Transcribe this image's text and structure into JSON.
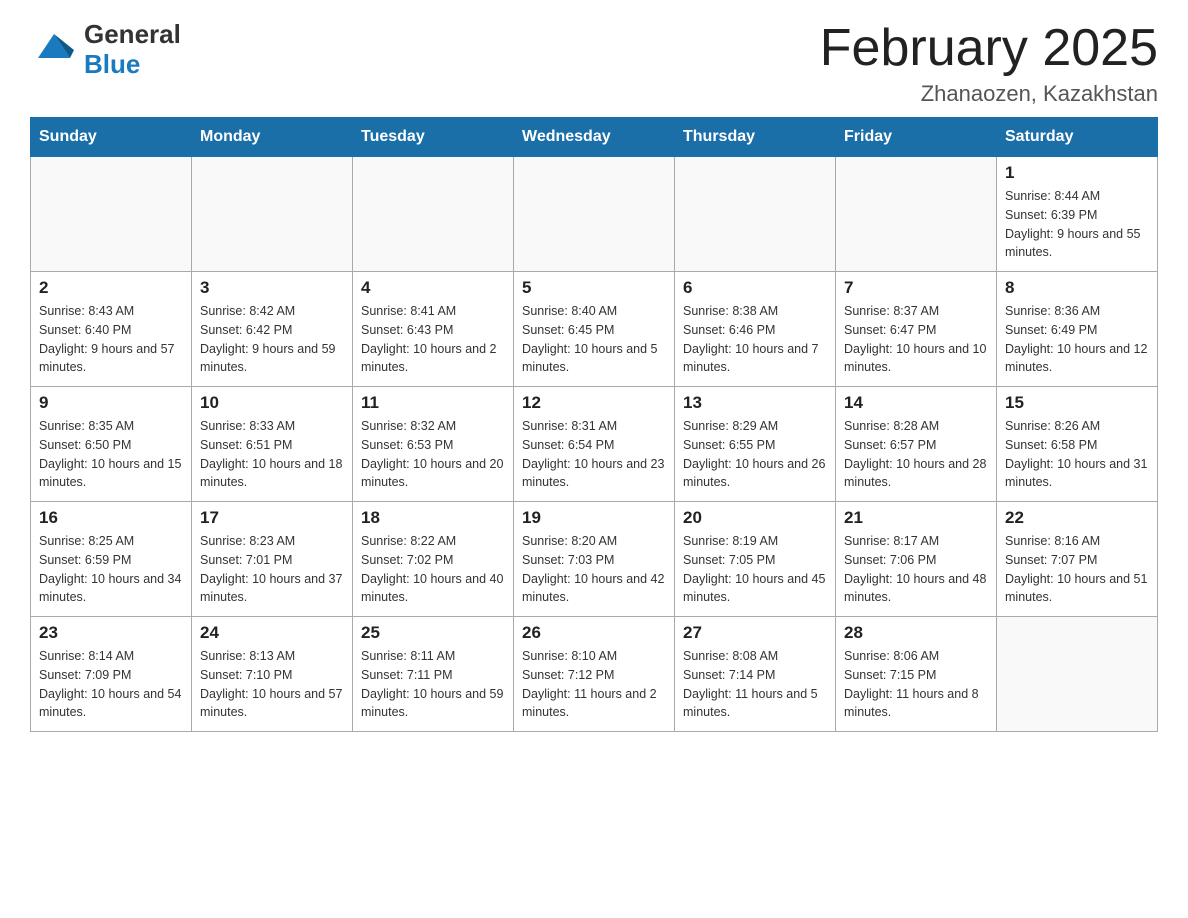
{
  "header": {
    "title": "February 2025",
    "location": "Zhanaozen, Kazakhstan"
  },
  "logo": {
    "general": "General",
    "blue": "Blue"
  },
  "days_of_week": [
    "Sunday",
    "Monday",
    "Tuesday",
    "Wednesday",
    "Thursday",
    "Friday",
    "Saturday"
  ],
  "weeks": [
    [
      {
        "date": "",
        "sunrise": "",
        "sunset": "",
        "daylight": ""
      },
      {
        "date": "",
        "sunrise": "",
        "sunset": "",
        "daylight": ""
      },
      {
        "date": "",
        "sunrise": "",
        "sunset": "",
        "daylight": ""
      },
      {
        "date": "",
        "sunrise": "",
        "sunset": "",
        "daylight": ""
      },
      {
        "date": "",
        "sunrise": "",
        "sunset": "",
        "daylight": ""
      },
      {
        "date": "",
        "sunrise": "",
        "sunset": "",
        "daylight": ""
      },
      {
        "date": "1",
        "sunrise": "Sunrise: 8:44 AM",
        "sunset": "Sunset: 6:39 PM",
        "daylight": "Daylight: 9 hours and 55 minutes."
      }
    ],
    [
      {
        "date": "2",
        "sunrise": "Sunrise: 8:43 AM",
        "sunset": "Sunset: 6:40 PM",
        "daylight": "Daylight: 9 hours and 57 minutes."
      },
      {
        "date": "3",
        "sunrise": "Sunrise: 8:42 AM",
        "sunset": "Sunset: 6:42 PM",
        "daylight": "Daylight: 9 hours and 59 minutes."
      },
      {
        "date": "4",
        "sunrise": "Sunrise: 8:41 AM",
        "sunset": "Sunset: 6:43 PM",
        "daylight": "Daylight: 10 hours and 2 minutes."
      },
      {
        "date": "5",
        "sunrise": "Sunrise: 8:40 AM",
        "sunset": "Sunset: 6:45 PM",
        "daylight": "Daylight: 10 hours and 5 minutes."
      },
      {
        "date": "6",
        "sunrise": "Sunrise: 8:38 AM",
        "sunset": "Sunset: 6:46 PM",
        "daylight": "Daylight: 10 hours and 7 minutes."
      },
      {
        "date": "7",
        "sunrise": "Sunrise: 8:37 AM",
        "sunset": "Sunset: 6:47 PM",
        "daylight": "Daylight: 10 hours and 10 minutes."
      },
      {
        "date": "8",
        "sunrise": "Sunrise: 8:36 AM",
        "sunset": "Sunset: 6:49 PM",
        "daylight": "Daylight: 10 hours and 12 minutes."
      }
    ],
    [
      {
        "date": "9",
        "sunrise": "Sunrise: 8:35 AM",
        "sunset": "Sunset: 6:50 PM",
        "daylight": "Daylight: 10 hours and 15 minutes."
      },
      {
        "date": "10",
        "sunrise": "Sunrise: 8:33 AM",
        "sunset": "Sunset: 6:51 PM",
        "daylight": "Daylight: 10 hours and 18 minutes."
      },
      {
        "date": "11",
        "sunrise": "Sunrise: 8:32 AM",
        "sunset": "Sunset: 6:53 PM",
        "daylight": "Daylight: 10 hours and 20 minutes."
      },
      {
        "date": "12",
        "sunrise": "Sunrise: 8:31 AM",
        "sunset": "Sunset: 6:54 PM",
        "daylight": "Daylight: 10 hours and 23 minutes."
      },
      {
        "date": "13",
        "sunrise": "Sunrise: 8:29 AM",
        "sunset": "Sunset: 6:55 PM",
        "daylight": "Daylight: 10 hours and 26 minutes."
      },
      {
        "date": "14",
        "sunrise": "Sunrise: 8:28 AM",
        "sunset": "Sunset: 6:57 PM",
        "daylight": "Daylight: 10 hours and 28 minutes."
      },
      {
        "date": "15",
        "sunrise": "Sunrise: 8:26 AM",
        "sunset": "Sunset: 6:58 PM",
        "daylight": "Daylight: 10 hours and 31 minutes."
      }
    ],
    [
      {
        "date": "16",
        "sunrise": "Sunrise: 8:25 AM",
        "sunset": "Sunset: 6:59 PM",
        "daylight": "Daylight: 10 hours and 34 minutes."
      },
      {
        "date": "17",
        "sunrise": "Sunrise: 8:23 AM",
        "sunset": "Sunset: 7:01 PM",
        "daylight": "Daylight: 10 hours and 37 minutes."
      },
      {
        "date": "18",
        "sunrise": "Sunrise: 8:22 AM",
        "sunset": "Sunset: 7:02 PM",
        "daylight": "Daylight: 10 hours and 40 minutes."
      },
      {
        "date": "19",
        "sunrise": "Sunrise: 8:20 AM",
        "sunset": "Sunset: 7:03 PM",
        "daylight": "Daylight: 10 hours and 42 minutes."
      },
      {
        "date": "20",
        "sunrise": "Sunrise: 8:19 AM",
        "sunset": "Sunset: 7:05 PM",
        "daylight": "Daylight: 10 hours and 45 minutes."
      },
      {
        "date": "21",
        "sunrise": "Sunrise: 8:17 AM",
        "sunset": "Sunset: 7:06 PM",
        "daylight": "Daylight: 10 hours and 48 minutes."
      },
      {
        "date": "22",
        "sunrise": "Sunrise: 8:16 AM",
        "sunset": "Sunset: 7:07 PM",
        "daylight": "Daylight: 10 hours and 51 minutes."
      }
    ],
    [
      {
        "date": "23",
        "sunrise": "Sunrise: 8:14 AM",
        "sunset": "Sunset: 7:09 PM",
        "daylight": "Daylight: 10 hours and 54 minutes."
      },
      {
        "date": "24",
        "sunrise": "Sunrise: 8:13 AM",
        "sunset": "Sunset: 7:10 PM",
        "daylight": "Daylight: 10 hours and 57 minutes."
      },
      {
        "date": "25",
        "sunrise": "Sunrise: 8:11 AM",
        "sunset": "Sunset: 7:11 PM",
        "daylight": "Daylight: 10 hours and 59 minutes."
      },
      {
        "date": "26",
        "sunrise": "Sunrise: 8:10 AM",
        "sunset": "Sunset: 7:12 PM",
        "daylight": "Daylight: 11 hours and 2 minutes."
      },
      {
        "date": "27",
        "sunrise": "Sunrise: 8:08 AM",
        "sunset": "Sunset: 7:14 PM",
        "daylight": "Daylight: 11 hours and 5 minutes."
      },
      {
        "date": "28",
        "sunrise": "Sunrise: 8:06 AM",
        "sunset": "Sunset: 7:15 PM",
        "daylight": "Daylight: 11 hours and 8 minutes."
      },
      {
        "date": "",
        "sunrise": "",
        "sunset": "",
        "daylight": ""
      }
    ]
  ]
}
